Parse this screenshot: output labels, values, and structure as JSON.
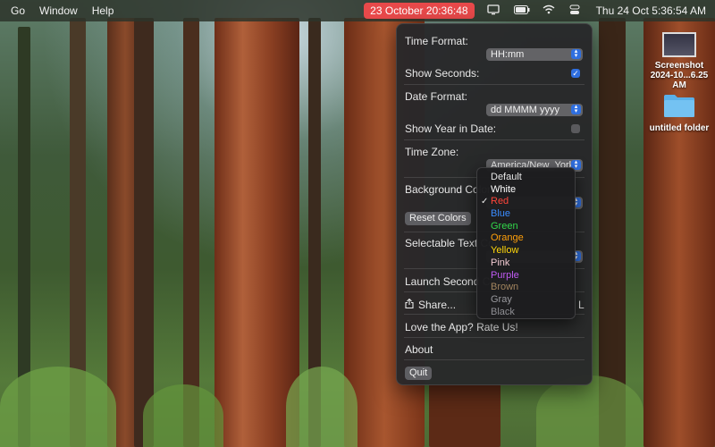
{
  "menubar": {
    "items": [
      "Go",
      "Window",
      "Help"
    ],
    "clock_badge": "23 October  20:36:48",
    "date_time": "Thu 24 Oct  5:36:54 AM"
  },
  "panel": {
    "time_format_label": "Time Format:",
    "time_format_value": "HH:mm",
    "show_seconds_label": "Show Seconds:",
    "show_seconds_checked": true,
    "date_format_label": "Date Format:",
    "date_format_value": "dd MMMM yyyy",
    "show_year_label": "Show Year in Date:",
    "show_year_checked": false,
    "time_zone_label": "Time Zone:",
    "time_zone_value": "America/New_York",
    "background_color_label": "Background Color:",
    "reset_colors_label": "Reset Colors",
    "selectable_text_color_label": "Selectable Text Color",
    "launch_second_clock_label": "Launch Second Clock",
    "share_label": "Share...",
    "share_trailing": "L",
    "rate_label": "Love the App? Rate Us!",
    "about_label": "About",
    "quit_label": "Quit"
  },
  "color_menu": {
    "selected": "Red",
    "options": [
      {
        "label": "Default",
        "color": "#e6e6e6"
      },
      {
        "label": "White",
        "color": "#ffffff"
      },
      {
        "label": "Red",
        "color": "#ff453a"
      },
      {
        "label": "Blue",
        "color": "#3a8cff"
      },
      {
        "label": "Green",
        "color": "#32d74b"
      },
      {
        "label": "Orange",
        "color": "#ff9f0a"
      },
      {
        "label": "Yellow",
        "color": "#ffd60a"
      },
      {
        "label": "Pink",
        "color": "#f0c8d0"
      },
      {
        "label": "Purple",
        "color": "#bf5af2"
      },
      {
        "label": "Brown",
        "color": "#a2845e"
      },
      {
        "label": "Gray",
        "color": "#98989d"
      },
      {
        "label": "Black",
        "color": "#8e8e93"
      }
    ]
  },
  "desktop": {
    "screenshot_label_1": "Screenshot",
    "screenshot_label_2": "2024-10...6.25 AM",
    "folder_label": "untitled folder"
  }
}
